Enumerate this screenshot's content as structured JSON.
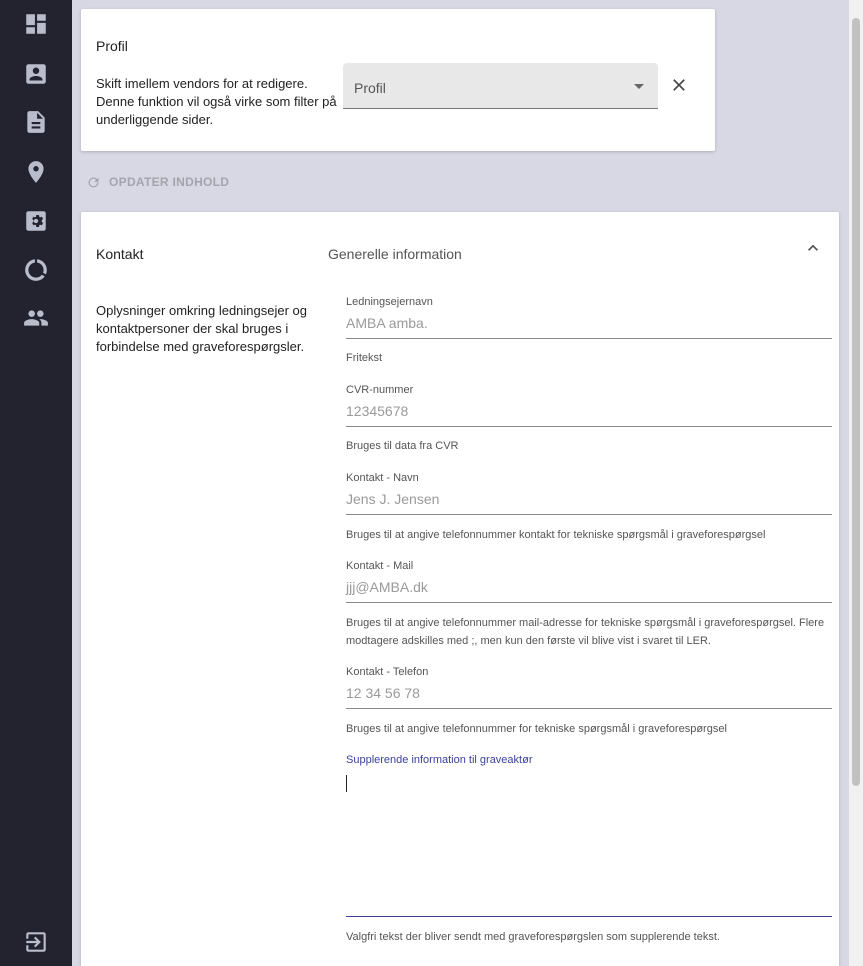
{
  "sidebar": {
    "items": [
      {
        "name": "dashboard-icon"
      },
      {
        "name": "account-box-icon"
      },
      {
        "name": "document-icon"
      },
      {
        "name": "location-pin-icon"
      },
      {
        "name": "settings-box-icon"
      },
      {
        "name": "progress-icon"
      },
      {
        "name": "people-icon"
      }
    ],
    "logout_icon": "logout-icon"
  },
  "profile_card": {
    "title": "Profil",
    "description": "Skift imellem vendors for at redigere. Denne funktion vil også virke som filter på underliggende sider.",
    "select_value": "Profil"
  },
  "update_button": {
    "label": "OPDATER INDHOLD"
  },
  "contact_section": {
    "title": "Kontakt",
    "subtitle": "Generelle information",
    "description": "Oplysninger omkring ledningsejer og kontaktpersoner der skal bruges i forbindelse med graveforespørgsler.",
    "fields": {
      "owner": {
        "label": "Ledningsejernavn",
        "placeholder": "AMBA amba.",
        "helper": "Fritekst"
      },
      "cvr": {
        "label": "CVR-nummer",
        "placeholder": "12345678",
        "helper": "Bruges til data fra CVR"
      },
      "name": {
        "label": "Kontakt - Navn",
        "placeholder": "Jens J. Jensen",
        "helper": "Bruges til at angive telefonnummer kontakt for tekniske spørgsmål i graveforespørgsel"
      },
      "mail": {
        "label": "Kontakt - Mail",
        "placeholder": "jjj@AMBA.dk",
        "helper": "Bruges til at angive telefonnummer mail-adresse for tekniske spørgsmål i graveforespørgsel. Flere modtagere adskilles med ;, men kun den første vil blive vist i svaret til LER."
      },
      "phone": {
        "label": "Kontakt - Telefon",
        "placeholder": "12 34 56 78",
        "helper": "Bruges til at angive telefonnummer for tekniske spørgsmål i graveforespørgsel"
      },
      "supplement": {
        "label": "Supplerende information til graveaktør",
        "helper": "Valgfri tekst der bliver sendt med graveforespørgslen som supplerende tekst."
      }
    }
  },
  "colors": {
    "sidebar": "#23232f",
    "background": "#d8d8e4",
    "accent": "#3a3fa0"
  }
}
